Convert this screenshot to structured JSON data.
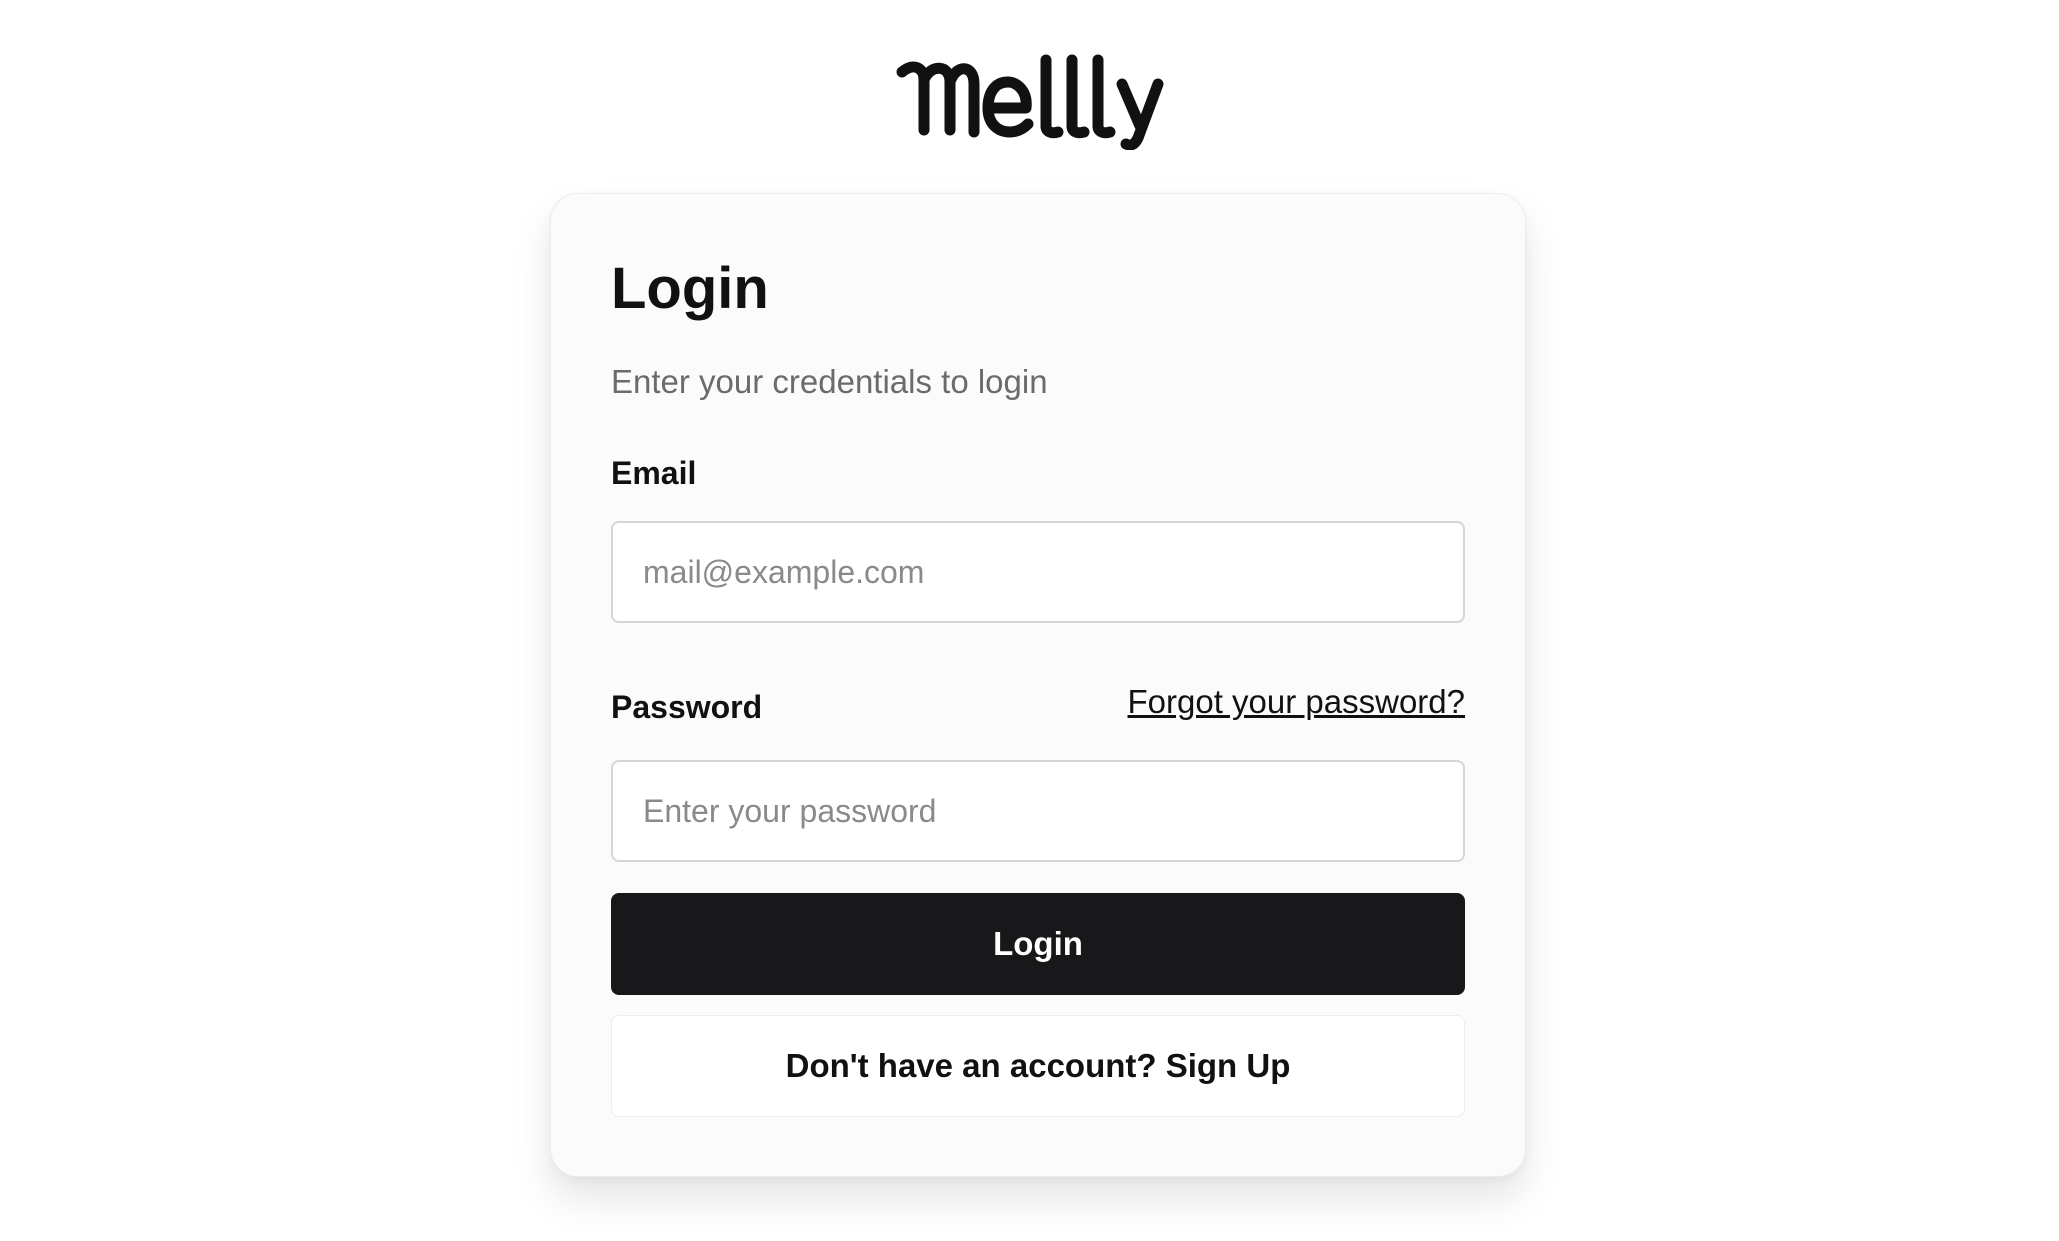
{
  "brand": {
    "logo_text": "Mellly"
  },
  "login_form": {
    "title": "Login",
    "subtitle": "Enter your credentials to login",
    "email": {
      "label": "Email",
      "value": "",
      "placeholder": "mail@example.com"
    },
    "password": {
      "label": "Password",
      "value": "",
      "placeholder": "Enter your password",
      "forgot_link": "Forgot your password?"
    },
    "submit_label": "Login",
    "signup_label": "Don't have an account? Sign Up"
  },
  "colors": {
    "primary_button": "#18181a",
    "primary_button_text": "#ffffff",
    "muted_text": "#6b6b6b",
    "card_background": "#fbfbfb"
  }
}
